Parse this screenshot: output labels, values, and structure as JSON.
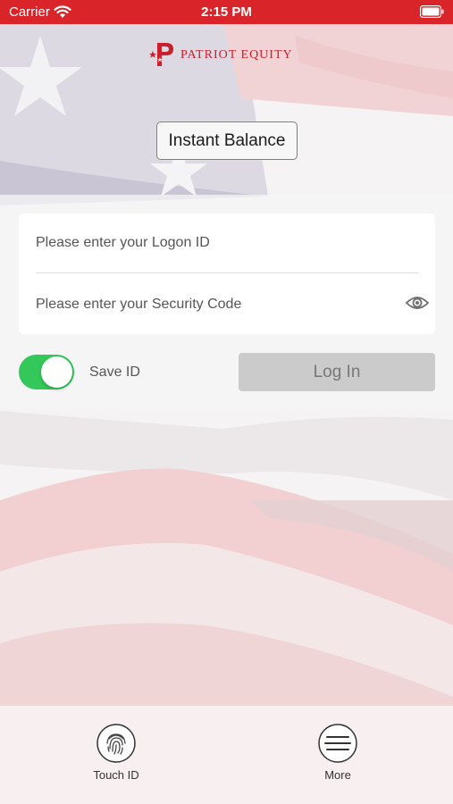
{
  "status_bar": {
    "carrier": "Carrier",
    "time": "2:15 PM"
  },
  "brand": {
    "name": "PATRIOT EQUITY",
    "color": "#c8202c"
  },
  "buttons": {
    "instant_balance": "Instant Balance",
    "log_in": "Log In"
  },
  "form": {
    "logon_placeholder": "Please enter your Logon ID",
    "security_placeholder": "Please enter your Security Code"
  },
  "save_id": {
    "label": "Save ID",
    "enabled": true,
    "color": "#34c759"
  },
  "tabbar": {
    "touch_id": "Touch ID",
    "more": "More"
  },
  "icons": [
    "wifi-icon",
    "battery-icon",
    "eye-icon",
    "fingerprint-icon",
    "menu-icon"
  ]
}
